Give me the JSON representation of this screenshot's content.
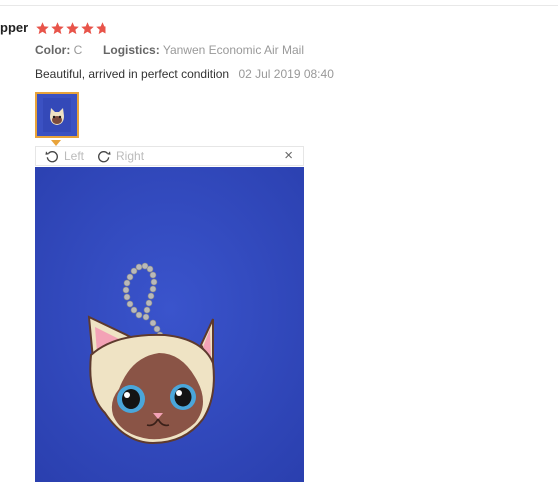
{
  "reviewer": {
    "name": "pper"
  },
  "rating": {
    "stars": 4.7,
    "max": 5
  },
  "attributes": {
    "color_key": "Color:",
    "color_value": "C",
    "logistics_key": "Logistics:",
    "logistics_value": "Yanwen Economic Air Mail"
  },
  "review": {
    "text": "Beautiful, arrived in perfect condition",
    "date": "02 Jul 2019 08:40"
  },
  "viewer": {
    "rotate_left_label": "Left",
    "rotate_right_label": "Right",
    "close_glyph": "×"
  },
  "colors": {
    "star": "#e8544a",
    "thumb_border": "#e8a33a",
    "photo_background": "#3048bf"
  },
  "icons": [
    "star-icon",
    "rotate-left-icon",
    "rotate-right-icon",
    "close-icon"
  ]
}
